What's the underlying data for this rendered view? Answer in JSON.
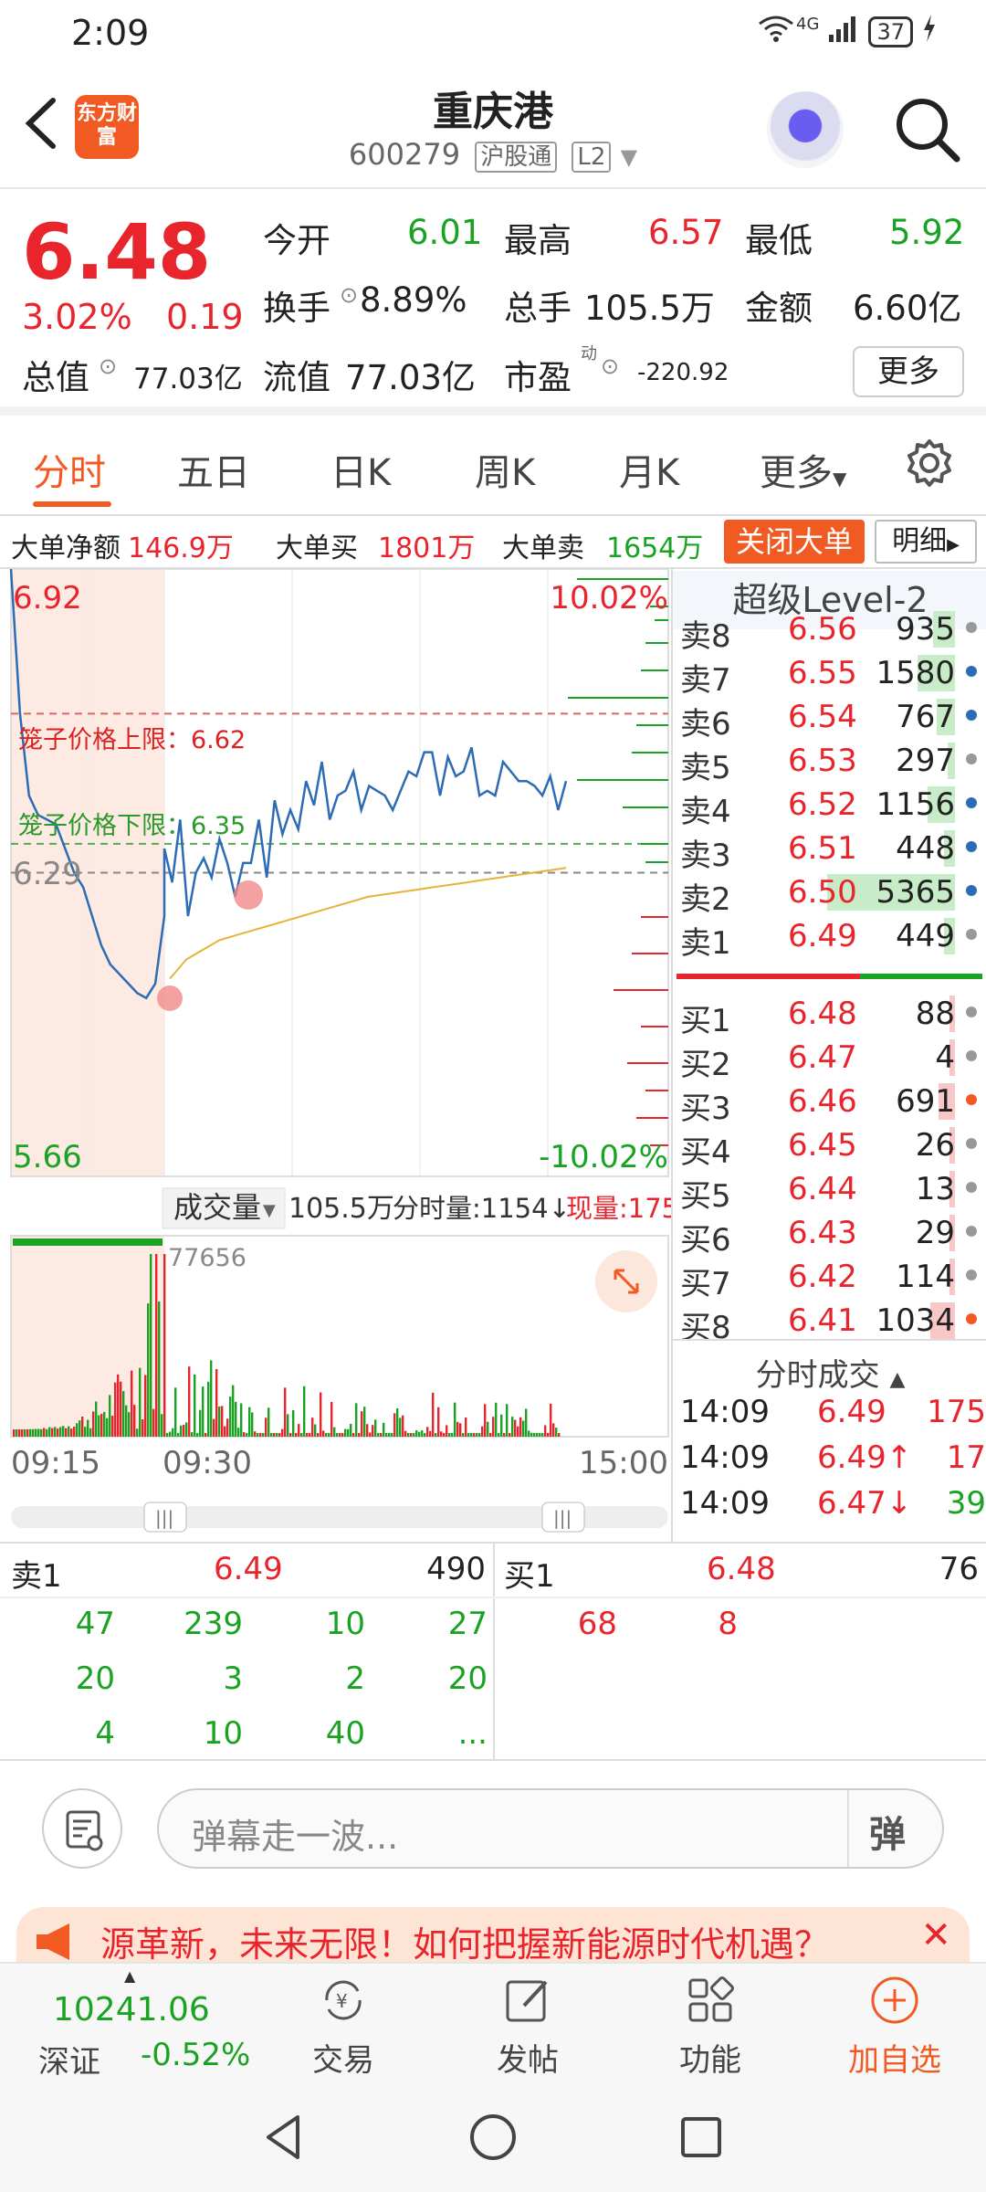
{
  "status": {
    "time": "2:09",
    "network": "4G",
    "battery": "37"
  },
  "header": {
    "logo_text": "东方财富",
    "title": "重庆港",
    "code": "600279",
    "tag1": "沪股通",
    "tag2": "L2"
  },
  "quote": {
    "price": "6.48",
    "pct": "3.02%",
    "change": "0.19",
    "open_label": "今开",
    "open": "6.01",
    "high_label": "最高",
    "high": "6.57",
    "low_label": "最低",
    "low": "5.92",
    "turnover_label": "换手",
    "turnover": "8.89%",
    "vol_label": "总手",
    "vol": "105.5万",
    "amount_label": "金额",
    "amount": "6.60亿",
    "mcap_label": "总值",
    "mcap": "77.03亿",
    "float_label": "流值",
    "float": "77.03亿",
    "pe_label": "市盈",
    "pe_sup": "动",
    "pe": "-220.92",
    "more": "更多"
  },
  "tabs": [
    "分时",
    "五日",
    "日K",
    "周K",
    "月K",
    "更多"
  ],
  "bigorder": {
    "net_label": "大单净额",
    "net": "146.9万",
    "buy_label": "大单买",
    "buy": "1801万",
    "sell_label": "大单卖",
    "sell": "1654万",
    "close_btn": "关闭大单",
    "detail_btn": "明细"
  },
  "chart_data": {
    "type": "line",
    "title": "",
    "y_top": "6.92",
    "y_bottom": "5.66",
    "y_prev": "6.29",
    "pct_top": "10.02%",
    "pct_bottom": "-10.02%",
    "upper_limit_label": "笼子价格上限：6.62",
    "lower_limit_label": "笼子价格下限：6.35",
    "ylim": [
      5.66,
      6.92
    ],
    "prev_close": 6.29,
    "upper_limit": 6.62,
    "lower_limit": 6.35,
    "x_labels": [
      "09:15",
      "09:30",
      "15:00"
    ],
    "price_series": [
      6.92,
      6.62,
      6.45,
      6.41,
      6.4,
      6.39,
      6.34,
      6.29,
      6.26,
      6.2,
      6.14,
      6.1,
      6.08,
      6.06,
      6.04,
      6.03,
      6.06,
      6.2,
      6.34,
      6.27,
      6.4,
      6.2,
      6.29,
      6.32,
      6.28,
      6.36,
      6.31,
      6.24,
      6.31,
      6.31,
      6.4,
      6.28,
      6.44,
      6.37,
      6.42,
      6.38,
      6.48,
      6.43,
      6.52,
      6.4,
      6.45,
      6.46,
      6.5,
      6.42,
      6.47,
      6.46,
      6.45,
      6.42,
      6.46,
      6.5,
      6.49,
      6.54,
      6.54,
      6.45,
      6.53,
      6.49,
      6.5,
      6.55,
      6.45,
      6.46,
      6.45,
      6.52,
      6.5,
      6.48,
      6.48,
      6.47,
      6.45,
      6.49,
      6.42,
      6.48
    ],
    "avg_series": [
      6.07,
      6.11,
      6.13,
      6.15,
      6.16,
      6.17,
      6.18,
      6.19,
      6.2,
      6.21,
      6.22,
      6.23,
      6.24,
      6.245,
      6.25,
      6.255,
      6.26,
      6.265,
      6.27,
      6.275,
      6.28,
      6.285,
      6.29,
      6.295,
      6.3
    ],
    "volume_label": "成交量",
    "volume_total": "105.5万",
    "fenshi_label": "分时量:1154↓",
    "now_label": "现量:175",
    "vol_peak": "77656"
  },
  "level2": {
    "title": "超级Level-2",
    "asks": [
      {
        "n": "卖8",
        "p": "6.56",
        "q": "935"
      },
      {
        "n": "卖7",
        "p": "6.55",
        "q": "1580"
      },
      {
        "n": "卖6",
        "p": "6.54",
        "q": "767"
      },
      {
        "n": "卖5",
        "p": "6.53",
        "q": "297"
      },
      {
        "n": "卖4",
        "p": "6.52",
        "q": "1156"
      },
      {
        "n": "卖3",
        "p": "6.51",
        "q": "448"
      },
      {
        "n": "卖2",
        "p": "6.50",
        "q": "5365"
      },
      {
        "n": "卖1",
        "p": "6.49",
        "q": "449"
      }
    ],
    "bids": [
      {
        "n": "买1",
        "p": "6.48",
        "q": "88"
      },
      {
        "n": "买2",
        "p": "6.47",
        "q": "4"
      },
      {
        "n": "买3",
        "p": "6.46",
        "q": "691"
      },
      {
        "n": "买4",
        "p": "6.45",
        "q": "26"
      },
      {
        "n": "买5",
        "p": "6.44",
        "q": "13"
      },
      {
        "n": "买6",
        "p": "6.43",
        "q": "29"
      },
      {
        "n": "买7",
        "p": "6.42",
        "q": "114"
      },
      {
        "n": "买8",
        "p": "6.41",
        "q": "1034"
      }
    ],
    "trades_title": "分时成交",
    "trades": [
      {
        "t": "14:09",
        "p": "6.49",
        "q": "175"
      },
      {
        "t": "14:09",
        "p": "6.49↑",
        "q": "17"
      },
      {
        "t": "14:09",
        "p": "6.47↓",
        "q": "39"
      }
    ]
  },
  "queue": {
    "sell_label": "卖1",
    "sell_price": "6.49",
    "sell_total": "490",
    "buy_label": "买1",
    "buy_price": "6.48",
    "buy_total": "76",
    "sell_rows": [
      [
        "47",
        "239",
        "10",
        "27"
      ],
      [
        "20",
        "3",
        "2",
        "20"
      ],
      [
        "4",
        "10",
        "40",
        "..."
      ]
    ],
    "buy_rows": [
      [
        "68",
        "8"
      ]
    ]
  },
  "input": {
    "placeholder": "弹幕走一波...",
    "dan": "弹"
  },
  "banner": {
    "text": "源革新，未来无限！如何把握新能源时代机遇？"
  },
  "bottomnav": {
    "index_value": "10241.06",
    "index_name": "深证",
    "index_change": "-0.52%",
    "trade": "交易",
    "post": "发帖",
    "func": "功能",
    "add": "加自选"
  }
}
